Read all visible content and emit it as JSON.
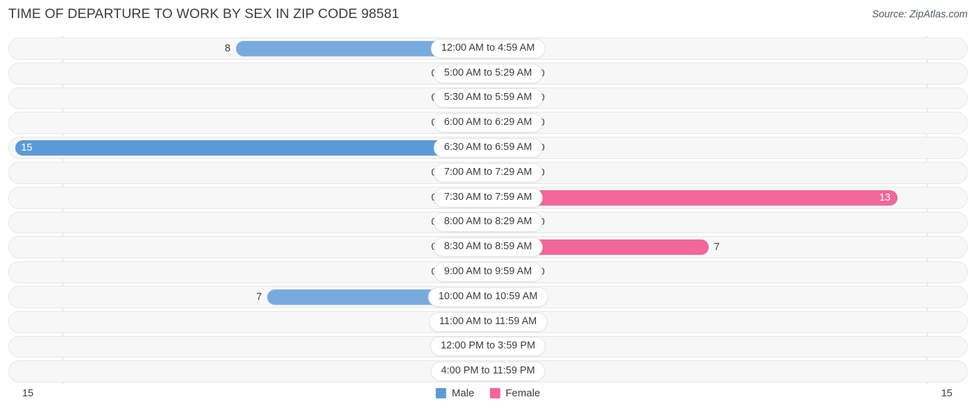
{
  "header": {
    "title": "TIME OF DEPARTURE TO WORK BY SEX IN ZIP CODE 98581",
    "source": "Source: ZipAtlas.com"
  },
  "legend": {
    "male_label": "Male",
    "female_label": "Female",
    "male_color": "#5b9bd5",
    "female_color": "#f2679a"
  },
  "axis": {
    "min_label": "15",
    "max_label": "15"
  },
  "chart_data": {
    "type": "bar",
    "title": "TIME OF DEPARTURE TO WORK BY SEX IN ZIP CODE 98581",
    "subtitle": "Source: ZipAtlas.com",
    "orientation": "horizontal-diverging",
    "xlabel": "",
    "ylabel": "",
    "xlim": [
      15,
      15
    ],
    "grid": true,
    "legend_position": "bottom-center",
    "categories": [
      "12:00 AM to 4:59 AM",
      "5:00 AM to 5:29 AM",
      "5:30 AM to 5:59 AM",
      "6:00 AM to 6:29 AM",
      "6:30 AM to 6:59 AM",
      "7:00 AM to 7:29 AM",
      "7:30 AM to 7:59 AM",
      "8:00 AM to 8:29 AM",
      "8:30 AM to 8:59 AM",
      "9:00 AM to 9:59 AM",
      "10:00 AM to 10:59 AM",
      "11:00 AM to 11:59 AM",
      "12:00 PM to 3:59 PM",
      "4:00 PM to 11:59 PM"
    ],
    "series": [
      {
        "name": "Male",
        "values": [
          8,
          0,
          0,
          0,
          15,
          0,
          0,
          0,
          0,
          0,
          7,
          0,
          0,
          0
        ]
      },
      {
        "name": "Female",
        "values": [
          0,
          0,
          0,
          0,
          0,
          0,
          13,
          0,
          7,
          0,
          0,
          0,
          0,
          0
        ]
      }
    ]
  },
  "rows": [
    {
      "label": "12:00 AM to 4:59 AM",
      "male": "8",
      "female": "0"
    },
    {
      "label": "5:00 AM to 5:29 AM",
      "male": "0",
      "female": "0"
    },
    {
      "label": "5:30 AM to 5:59 AM",
      "male": "0",
      "female": "0"
    },
    {
      "label": "6:00 AM to 6:29 AM",
      "male": "0",
      "female": "0"
    },
    {
      "label": "6:30 AM to 6:59 AM",
      "male": "15",
      "female": "0"
    },
    {
      "label": "7:00 AM to 7:29 AM",
      "male": "0",
      "female": "0"
    },
    {
      "label": "7:30 AM to 7:59 AM",
      "male": "0",
      "female": "13"
    },
    {
      "label": "8:00 AM to 8:29 AM",
      "male": "0",
      "female": "0"
    },
    {
      "label": "8:30 AM to 8:59 AM",
      "male": "0",
      "female": "7"
    },
    {
      "label": "9:00 AM to 9:59 AM",
      "male": "0",
      "female": "0"
    },
    {
      "label": "10:00 AM to 10:59 AM",
      "male": "7",
      "female": "0"
    },
    {
      "label": "11:00 AM to 11:59 AM",
      "male": "0",
      "female": "0"
    },
    {
      "label": "12:00 PM to 3:59 PM",
      "male": "0",
      "female": "0"
    },
    {
      "label": "4:00 PM to 11:59 PM",
      "male": "0",
      "female": "0"
    }
  ]
}
